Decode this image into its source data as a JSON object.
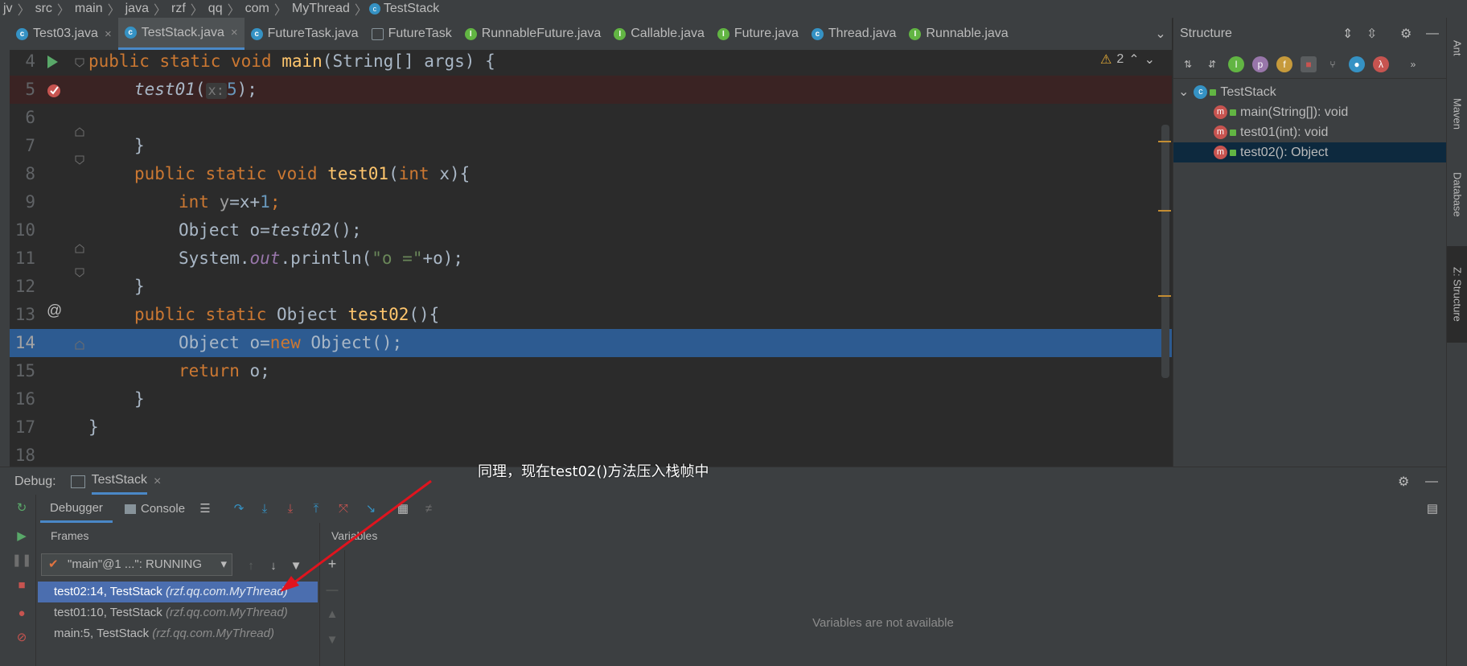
{
  "breadcrumb": [
    "jv",
    "src",
    "main",
    "java",
    "rzf",
    "qq",
    "com",
    "MyThread",
    "TestStack"
  ],
  "tabs": [
    {
      "label": "Test03.java",
      "icon": "class-icon",
      "close": "×"
    },
    {
      "label": "TestStack.java",
      "icon": "class-icon",
      "close": "×",
      "active": true
    },
    {
      "label": "FutureTask.java",
      "icon": "class-icon"
    },
    {
      "label": "FutureTask",
      "icon": "structure-icon"
    },
    {
      "label": "RunnableFuture.java",
      "icon": "interface-icon"
    },
    {
      "label": "Callable.java",
      "icon": "interface-icon"
    },
    {
      "label": "Future.java",
      "icon": "interface-icon"
    },
    {
      "label": "Thread.java",
      "icon": "class-icon"
    },
    {
      "label": "Runnable.java",
      "icon": "interface-icon"
    }
  ],
  "editor": {
    "warnings": "2",
    "lines": [
      {
        "n": "4"
      },
      {
        "n": "5"
      },
      {
        "n": "6"
      },
      {
        "n": "7"
      },
      {
        "n": "8"
      },
      {
        "n": "9"
      },
      {
        "n": "10"
      },
      {
        "n": "11"
      },
      {
        "n": "12"
      },
      {
        "n": "13"
      },
      {
        "n": "14"
      },
      {
        "n": "15"
      },
      {
        "n": "16"
      },
      {
        "n": "17"
      },
      {
        "n": "18"
      }
    ],
    "code": {
      "l4": {
        "a": "public static void ",
        "b": "main",
        "c": "(String[] args) {"
      },
      "l5": {
        "a": "test01",
        "b": "(",
        "hint": "x:",
        "c": "5",
        "d": ");"
      },
      "l7": {
        "a": "}"
      },
      "l8": {
        "a": "public static void ",
        "b": "test01",
        "c": "(",
        "d": "int",
        "e": " x){"
      },
      "l9": {
        "a": "int ",
        "b": "y",
        "c": "=x+",
        "d": "1",
        "e": ";"
      },
      "l10": {
        "a": "Object o=",
        "b": "test02",
        "c": "();"
      },
      "l11": {
        "a": "System.",
        "b": "out",
        "c": ".println(",
        "d": "\"o =\"",
        "e": "+o);"
      },
      "l12": {
        "a": "}"
      },
      "l13": {
        "a": "public static ",
        "b": "Object ",
        "c": "test02",
        "d": "(){"
      },
      "l14": {
        "a": "Object o=",
        "b": "new ",
        "c": "Object();"
      },
      "l15": {
        "a": "return ",
        "b": "o;"
      },
      "l16": {
        "a": "}"
      },
      "l17": {
        "a": "}"
      }
    }
  },
  "structure": {
    "title": "Structure",
    "root": "TestStack",
    "items": [
      "main(String[]): void",
      "test01(int): void",
      "test02(): Object"
    ],
    "selected_index": 2,
    "toolbar_letters": {
      "p": "p",
      "f": "f",
      "lambda": "λ",
      "more": "»"
    }
  },
  "right_strip": [
    "Ant",
    "Maven",
    "Database",
    "Z: Structure"
  ],
  "debug": {
    "label": "Debug:",
    "session": "TestStack",
    "tabs": [
      "Debugger",
      "Console"
    ],
    "frames_title": "Frames",
    "variables_title": "Variables",
    "thread": "\"main\"@1 ...\": RUNNING",
    "frames": [
      {
        "method": "test02:14, TestStack ",
        "pkg": "(rzf.qq.com.MyThread)"
      },
      {
        "method": "test01:10, TestStack ",
        "pkg": "(rzf.qq.com.MyThread)"
      },
      {
        "method": "main:5, TestStack ",
        "pkg": "(rzf.qq.com.MyThread)"
      }
    ],
    "selected_frame": 0,
    "variables_empty": "Variables are not available"
  },
  "annotation": "同理，现在test02()方法压入栈帧中",
  "colors": {
    "accent": "#4a88c7",
    "current_line": "#2d5b91",
    "selected_frame": "#4b6eaf",
    "arrow": "#e0141e"
  }
}
